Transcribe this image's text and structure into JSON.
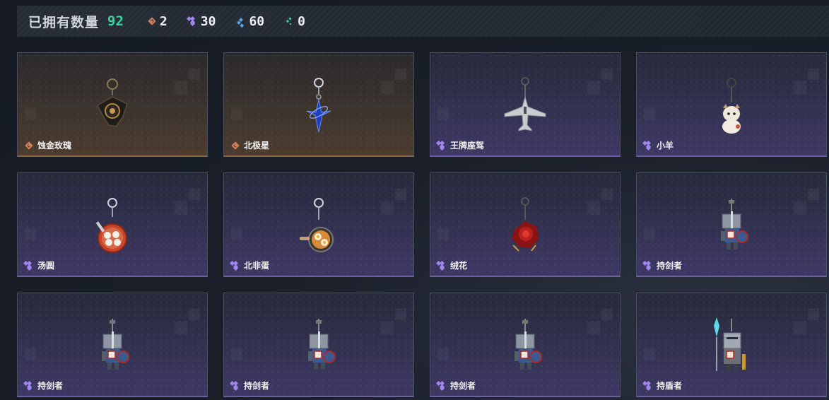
{
  "header": {
    "owned_label": "已拥有数量",
    "owned_count": "92",
    "stats": [
      {
        "icon": "orange-diamond-icon",
        "value": "2"
      },
      {
        "icon": "purple-diamond-icon",
        "value": "30"
      },
      {
        "icon": "blue-diamond-icon",
        "value": "60"
      },
      {
        "icon": "green-diamond-icon",
        "value": "0"
      }
    ]
  },
  "items": [
    {
      "name": "蚀金玫瑰",
      "rarity": "orange",
      "art": "dark-rose-pendant"
    },
    {
      "name": "北极星",
      "rarity": "orange",
      "art": "blue-star-pendant"
    },
    {
      "name": "王牌座驾",
      "rarity": "purple",
      "art": "jet-plane-pendant"
    },
    {
      "name": "小羊",
      "rarity": "purple",
      "art": "lamb-figure-pendant"
    },
    {
      "name": "汤圆",
      "rarity": "purple",
      "art": "tangyuan-bowl-pendant"
    },
    {
      "name": "北非蛋",
      "rarity": "purple",
      "art": "shakshuka-pan-pendant"
    },
    {
      "name": "绒花",
      "rarity": "purple",
      "art": "red-flower-pendant"
    },
    {
      "name": "持剑者",
      "rarity": "purple",
      "art": "sword-knight-pendant"
    },
    {
      "name": "持剑者",
      "rarity": "purple",
      "art": "sword-knight-pendant"
    },
    {
      "name": "持剑者",
      "rarity": "purple",
      "art": "sword-knight-pendant"
    },
    {
      "name": "持剑者",
      "rarity": "purple",
      "art": "sword-knight-pendant"
    },
    {
      "name": "持盾者",
      "rarity": "purple",
      "art": "shield-knight-pendant"
    }
  ],
  "colors": {
    "accent_green": "#35d6a0",
    "orange": "#d8845a",
    "purple": "#a286f0",
    "blue": "#5aa8e8"
  }
}
